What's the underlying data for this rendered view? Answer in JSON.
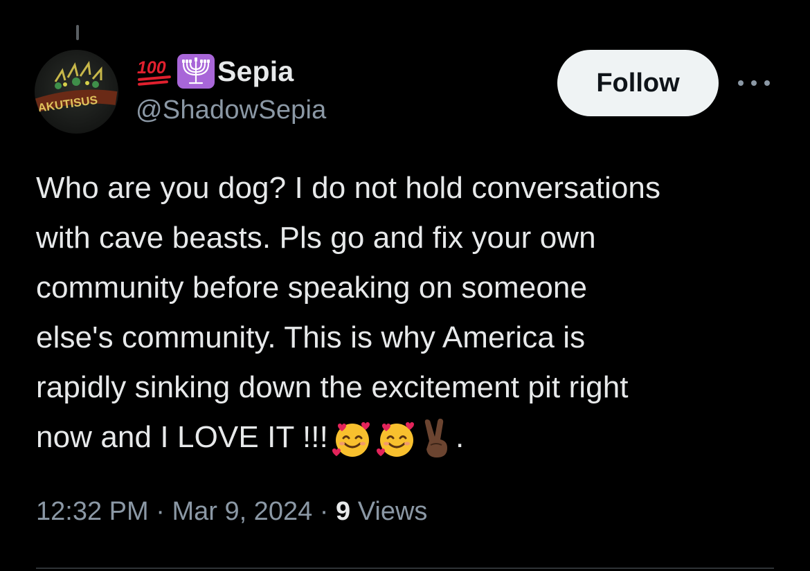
{
  "tweet": {
    "author": {
      "display_name": "Sepia",
      "handle": "@ShadowSepia",
      "name_emojis": [
        "hundred-points-icon",
        "menorah-icon"
      ],
      "avatar_text": "AKUTISUS"
    },
    "follow_label": "Follow",
    "text_lines": [
      "Who are you dog? I do not hold conversations",
      "with cave beasts. Pls go and fix your own",
      "community before speaking on someone",
      "else's community. This is why America is",
      "rapidly sinking down the excitement pit right",
      "now and I LOVE IT !!!"
    ],
    "trailing_text": ".",
    "text_emojis": [
      "smiling-face-with-hearts-icon",
      "smiling-face-with-hearts-icon",
      "victory-hand-icon"
    ],
    "time": "12:32 PM",
    "separator": "·",
    "date": "Mar 9, 2024",
    "views_count": "9",
    "views_label": "Views"
  },
  "colors": {
    "background": "#000000",
    "text_primary": "#e7e9ea",
    "text_secondary": "#8b98a5",
    "follow_bg": "#eff3f4",
    "menorah_bg": "#a866d8"
  }
}
